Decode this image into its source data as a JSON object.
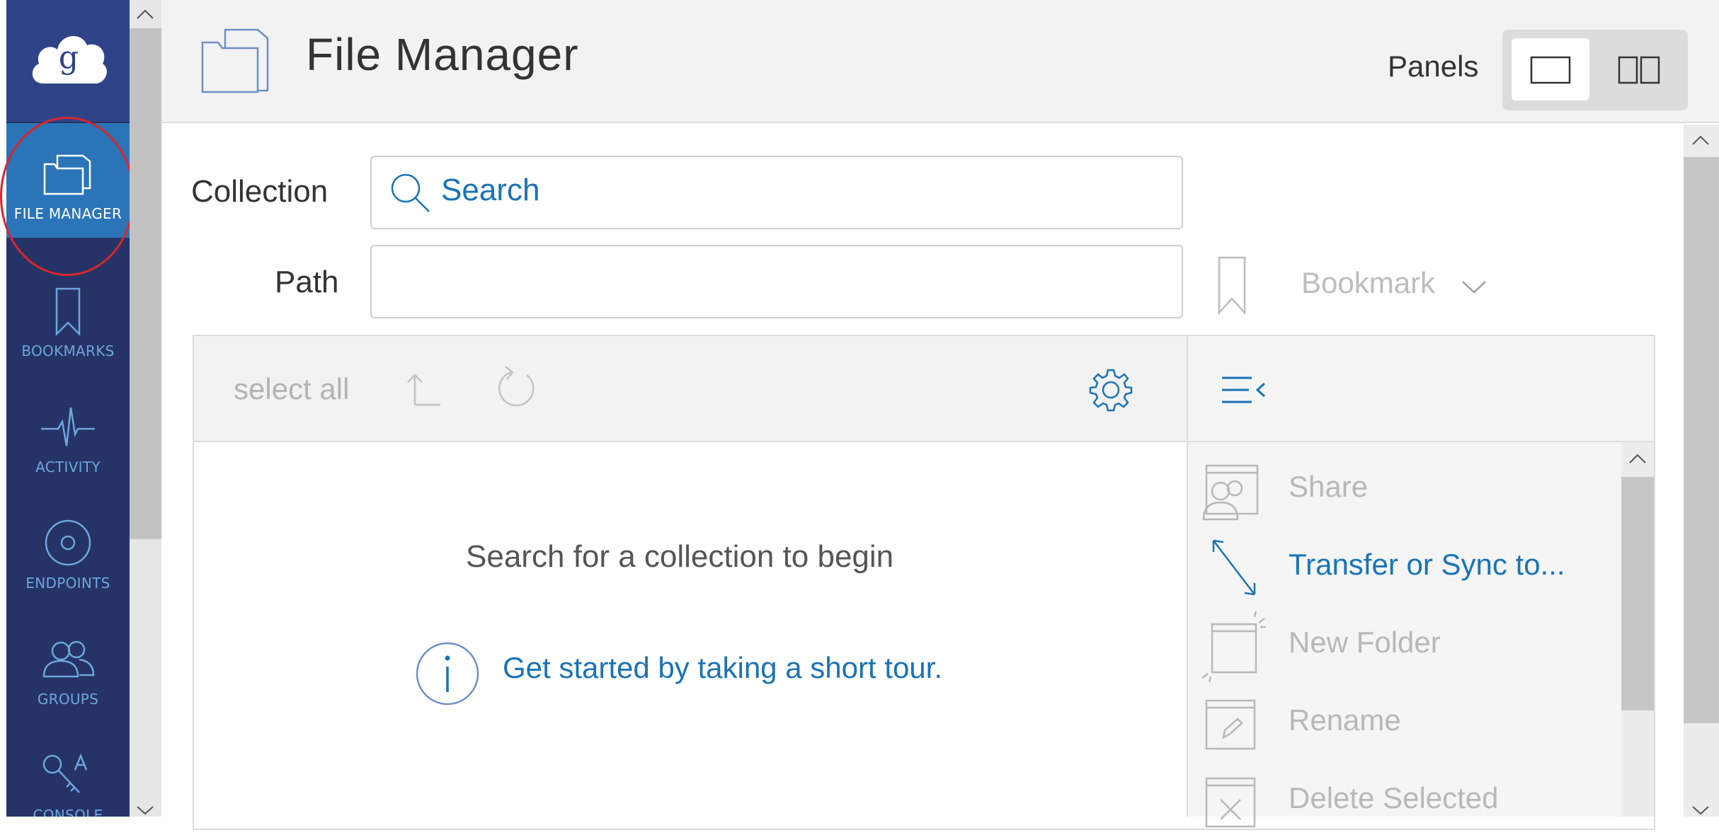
{
  "app": {
    "title": "File Manager"
  },
  "sidebar": {
    "items": [
      {
        "label": "FILE MANAGER",
        "icon": "folder-icon",
        "active": true
      },
      {
        "label": "BOOKMARKS",
        "icon": "bookmark-icon",
        "active": false
      },
      {
        "label": "ACTIVITY",
        "icon": "activity-pulse-icon",
        "active": false
      },
      {
        "label": "ENDPOINTS",
        "icon": "endpoint-circle-icon",
        "active": false
      },
      {
        "label": "GROUPS",
        "icon": "groups-icon",
        "active": false
      },
      {
        "label": "CONSOLE",
        "icon": "console-key-icon",
        "active": false
      }
    ]
  },
  "header": {
    "panels_label": "Panels",
    "panel_options": [
      "single-panel-icon",
      "double-panel-icon"
    ],
    "selected_panel": "single-panel-icon"
  },
  "form": {
    "collection_label": "Collection",
    "collection_placeholder": "Search",
    "path_label": "Path",
    "path_value": "",
    "bookmark_label": "Bookmark"
  },
  "toolbar": {
    "select_all": "select all"
  },
  "main": {
    "empty_message": "Search for a collection to begin",
    "tour_link": "Get started by taking a short tour."
  },
  "actions": [
    {
      "label": "Share",
      "icon": "share-folder-icon",
      "enabled": false
    },
    {
      "label": "Transfer or Sync to...",
      "icon": "transfer-arrows-icon",
      "enabled": true
    },
    {
      "label": "New Folder",
      "icon": "new-folder-icon",
      "enabled": false
    },
    {
      "label": "Rename",
      "icon": "rename-folder-icon",
      "enabled": false
    },
    {
      "label": "Delete Selected",
      "icon": "delete-folder-icon",
      "enabled": false
    }
  ],
  "colors": {
    "sidebar_bg": "#253366",
    "sidebar_active": "#2b74b8",
    "link_blue": "#1a73b5",
    "highlight_ring": "#d9262c"
  }
}
